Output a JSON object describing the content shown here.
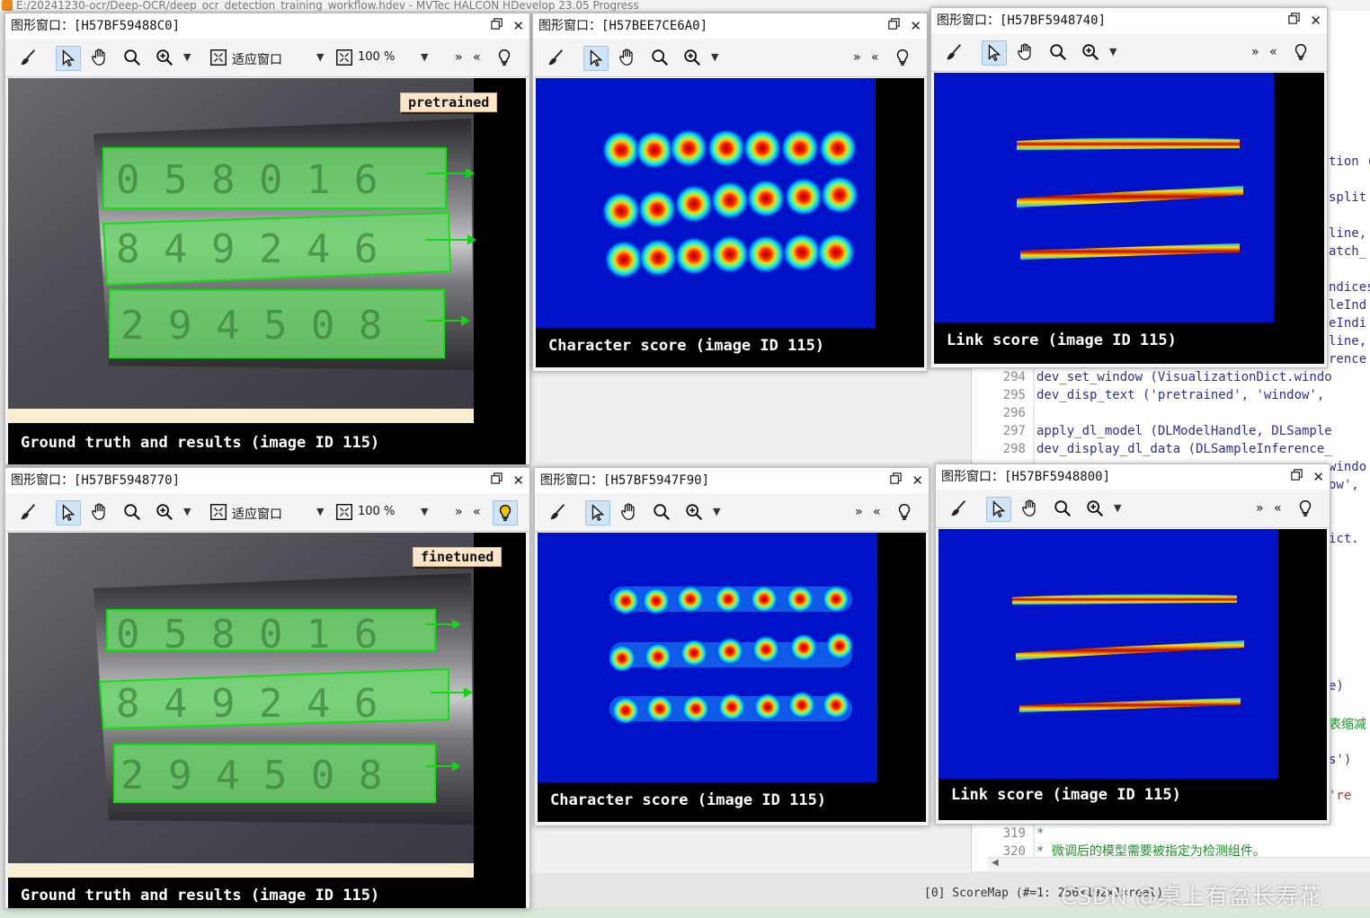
{
  "app_title": "E:/20241230-ocr/Deep-OCR/deep_ocr_detection_training_workflow.hdev - MVTec HALCON HDevelop 23.05 Progress",
  "toolbar": {
    "zoom_fit_label": "适应窗口",
    "zoom_percent": "100 %",
    "more": "»",
    "less": "«"
  },
  "windows": {
    "gt_top": {
      "id": "图形窗口：[H57BF59488C0]",
      "tag": "pretrained",
      "caption": "Ground truth and results (image ID 115)",
      "digits": [
        "0 5 8 0 1 6",
        "8 4 9 2 4 6",
        "2 9 4 5 0 8"
      ]
    },
    "char_top": {
      "id": "图形窗口：[H57BEE7CE6A0]",
      "caption": "Character score (image ID 115)"
    },
    "link_top": {
      "id": "图形窗口：[H57BF5948740]",
      "caption": "Link score (image ID 115)"
    },
    "gt_bottom": {
      "id": "图形窗口：[H57BF5948770]",
      "tag": "finetuned",
      "caption": "Ground truth and results (image ID 115)",
      "digits": [
        "0 5 8 0 1 6",
        "8 4 9 2 4 6",
        "2 9 4 5 0 8"
      ]
    },
    "char_bottom": {
      "id": "图形窗口：[H57BF5947F90]",
      "caption": "Character score (image ID 115)"
    },
    "link_bottom": {
      "id": "图形窗口：[H57BF5948800]",
      "caption": "Link score (image ID 115)"
    }
  },
  "editor": {
    "lines": [
      {
        "num": "294",
        "text": "dev_set_window (VisualizationDict.windo"
      },
      {
        "num": "295",
        "text": "dev_disp_text ('pretrained', 'window',"
      },
      {
        "num": "296",
        "text": ""
      },
      {
        "num": "297",
        "text": "apply_dl_model (DLModelHandle, DLSample"
      },
      {
        "num": "298",
        "text": "dev_display_dl_data (DLSampleInference_"
      },
      {
        "num": "319",
        "text": "*"
      },
      {
        "num": "320",
        "text": "* 微调后的模型需要被指定为检测组件。"
      }
    ],
    "fragments": [
      "tion (",
      "split",
      "line,",
      "atch_",
      "ndices",
      "leInd",
      "eIndi",
      "line,",
      "rence",
      "windo",
      "ow',",
      "ict.",
      "e)",
      "表缩减",
      "s')",
      "'re"
    ]
  },
  "status_text": "[0] ScoreMap (#=1: 256×192×1×real)",
  "watermark": "CSDN @桌上有盆长寿花"
}
